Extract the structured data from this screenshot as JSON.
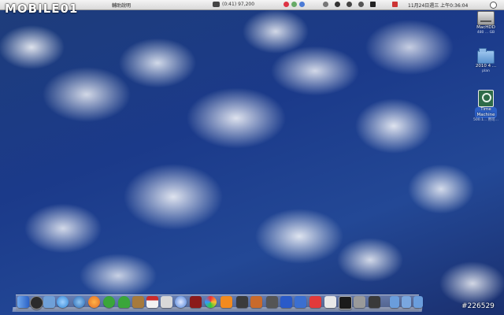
{
  "watermark": {
    "brand": "MOBILE01"
  },
  "menubar": {
    "apple_label": "",
    "menu_help": "輔助說明",
    "battery_text": "(0:41) 97,200",
    "clock": "11月24日週三 上午0:36:04"
  },
  "desktop_items": [
    {
      "name": "MacHDD",
      "sub": "480 ... GB"
    },
    {
      "name": "2010 4 ...",
      "sub": "plan"
    },
    {
      "name": "Time",
      "name2": "Machine",
      "sub": "500.1... 用可..."
    }
  ],
  "dock": {
    "apps": [
      "finder-icon",
      "dashboard-icon",
      "mail-icon",
      "safari-icon",
      "firefox-icon",
      "messenger-icon",
      "adium-icon",
      "address-book-icon",
      "ical-icon",
      "preview-icon",
      "itunes-icon",
      "photo-booth-icon",
      "iphoto-icon",
      "chess-icon",
      "keynote-icon",
      "script-editor-icon",
      "photoshop-icon",
      "spaces-icon",
      "crossover-icon",
      "textedit-icon",
      "terminal-icon",
      "system-preferences-icon",
      "grid-icon"
    ],
    "colors": {
      "finder": "#4a7fd8",
      "dashboard": "#2b2b2b",
      "mail": "#6fa0d8",
      "safari": "#2f86d6",
      "firefox": "#e26a23",
      "green": "#3aa63a",
      "brown": "#a67a3c",
      "calendar": "#d8d8d8",
      "red": "#cc2b2b",
      "orange": "#f28a1e",
      "dark": "#2a2a2a",
      "gray": "#9a9a9a"
    }
  },
  "stamp": "#226529"
}
